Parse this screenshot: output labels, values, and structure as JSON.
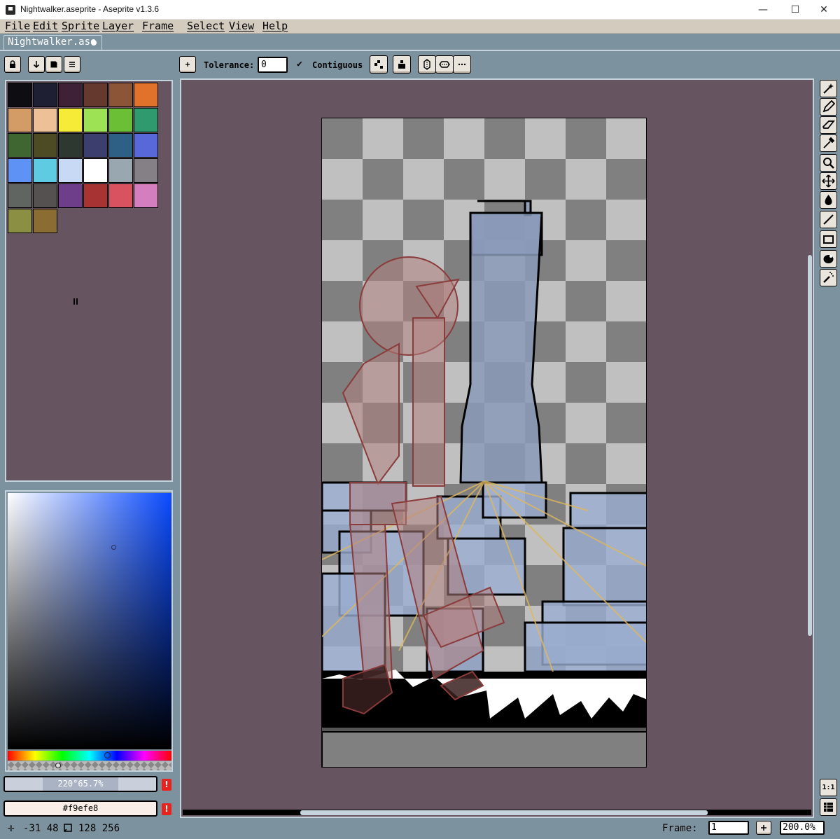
{
  "window": {
    "title": "Nightwalker.aseprite - Aseprite v1.3.6",
    "minimize_glyph": "—",
    "maximize_glyph": "☐",
    "close_glyph": "✕"
  },
  "menu": {
    "items": [
      "File",
      "Edit",
      "Sprite",
      "Layer",
      "Frame",
      "Select",
      "View",
      "Help"
    ]
  },
  "tabs": [
    {
      "label": "Nightwalker.ase",
      "modified": true
    }
  ],
  "context_bar": {
    "tolerance_label": "Tolerance:",
    "tolerance_value": "0",
    "contiguous_label": "Contiguous",
    "contiguous_checked": true
  },
  "palette": {
    "colors": [
      "#0e0e12",
      "#1f1f33",
      "#3f2137",
      "#65392e",
      "#8c5537",
      "#e0722b",
      "#d39c66",
      "#eec097",
      "#f6ec37",
      "#9de154",
      "#6abf35",
      "#2f9a6e",
      "#3f6530",
      "#4d4b24",
      "#2d3830",
      "#3c3f6e",
      "#2e5f85",
      "#5868d8",
      "#5e92f4",
      "#5ecbe2",
      "#c8d9f6",
      "#ffffff",
      "#99a7b0",
      "#857f86",
      "#606562",
      "#555150",
      "#6f3e8b",
      "#a83333",
      "#d9525f",
      "#d47ebf",
      "#8b8f43",
      "#8b6c33"
    ]
  },
  "color_picker": {
    "hsv_value": "220°65.7%",
    "hex_value": "#f9efe8",
    "warning_glyph": "!",
    "hue_accent": "#0a4aff"
  },
  "status": {
    "cursor_icon": "crosshair-icon",
    "cursor_position": "-31 48",
    "size_icon": "selection-size-icon",
    "sprite_size": "128 256",
    "frame_label": "Frame:",
    "frame_value": "1",
    "zoom_value": "200.0%"
  },
  "tools": [
    "magic-wand",
    "pencil",
    "eraser",
    "eyedropper",
    "zoom",
    "move",
    "paint-bucket",
    "line",
    "rectangle",
    "blur",
    "spray"
  ],
  "bottom_tools": [
    "one-to-one",
    "timeline"
  ]
}
